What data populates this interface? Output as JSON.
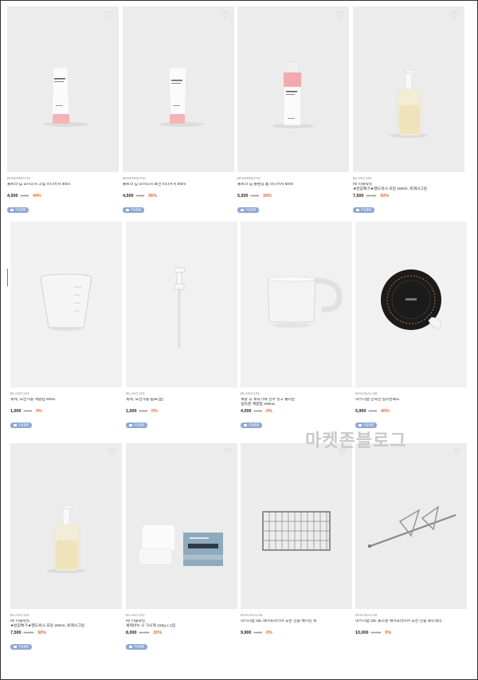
{
  "watermark": "마켓존블로그",
  "products": [
    {
      "brand": "BIOERMATIC",
      "name": "울트라 딥 모이스처 크림 미니어처 30ml",
      "price": "4,500",
      "orig": "8,000",
      "disc": "44%",
      "badge": "오늘출발",
      "icon": "cream-tube"
    },
    {
      "brand": "BIOERMATIC",
      "name": "울트라 딥 모이스처 로션 미니어처 50ml",
      "price": "4,500",
      "orig": "7,000",
      "disc": "36%",
      "badge": "오늘출발",
      "icon": "lotion-tube"
    },
    {
      "brand": "BIOERMATIC",
      "name": "울트라 딥 클렌징 폼 미니어처 50ml",
      "price": "5,500",
      "orig": "9,000",
      "disc": "39%",
      "badge": "오늘출발",
      "icon": "foam-bottle"
    },
    {
      "brand": "BLANC101",
      "name": "#2 이블락킹\n★반값특가★핸드워시 포밍 280ml, 트래시그린",
      "price": "7,500",
      "orig": "15,000",
      "disc": "50%",
      "badge": "오늘출발",
      "icon": "pump-bottle"
    },
    {
      "brand": "BLANC101",
      "name": "세제, 오면가용 계량컵 50mL",
      "price": "1,000",
      "orig": "1,000",
      "disc": "0%",
      "badge": "오늘출발",
      "icon": "measuring-cup"
    },
    {
      "brand": "BLANC101",
      "name": "세제, 오면가용 펌프(캡)",
      "price": "1,000",
      "orig": "1,000",
      "disc": "0%",
      "badge": "오늘출발",
      "icon": "pump-head"
    },
    {
      "brand": "BLANC101",
      "name": "계량 후 세탁기에 한꺼 넣고 돌리는\n실리콘 계량컵 200mL",
      "price": "4,000",
      "orig": "4,000",
      "disc": "0%",
      "badge": "오늘출발",
      "icon": "silicone-cup"
    },
    {
      "brand": "MAKINALAB",
      "name": "마키나랩 인덕션 실리콘패드",
      "price": "5,900",
      "orig": "9,900",
      "disc": "40%",
      "badge": "오늘출발",
      "icon": "induction-pad"
    },
    {
      "brand": "BLANC101",
      "name": "#2 이블락킹\n★반값특가★핸드워시 포밍 280ml, 트래시그린",
      "price": "7,500",
      "orig": "15,000",
      "disc": "50%",
      "badge": "오늘출발",
      "icon": "pump-bottle-2"
    },
    {
      "brand": "BLANC101",
      "name": "#2 이블락킹\n세제비누 시 가시제 150g x 2입",
      "price": "8,000",
      "orig": "10,000",
      "disc": "20%",
      "badge": "오늘출발",
      "icon": "soap-bars"
    },
    {
      "brand": "MAKINALAB",
      "name": "마키나랩 18L 에어프라이어 오븐 전용 베이킹 랙",
      "price": "9,900",
      "orig": "9,900",
      "disc": "0%",
      "badge": "",
      "icon": "baking-rack"
    },
    {
      "brand": "MAKINALAB",
      "name": "마키나랩 25L 올스텐 에어프라이어 오븐 전용 로티세리",
      "price": "10,000",
      "orig": "10,000",
      "disc": "0%",
      "badge": "",
      "icon": "rotisserie"
    }
  ]
}
